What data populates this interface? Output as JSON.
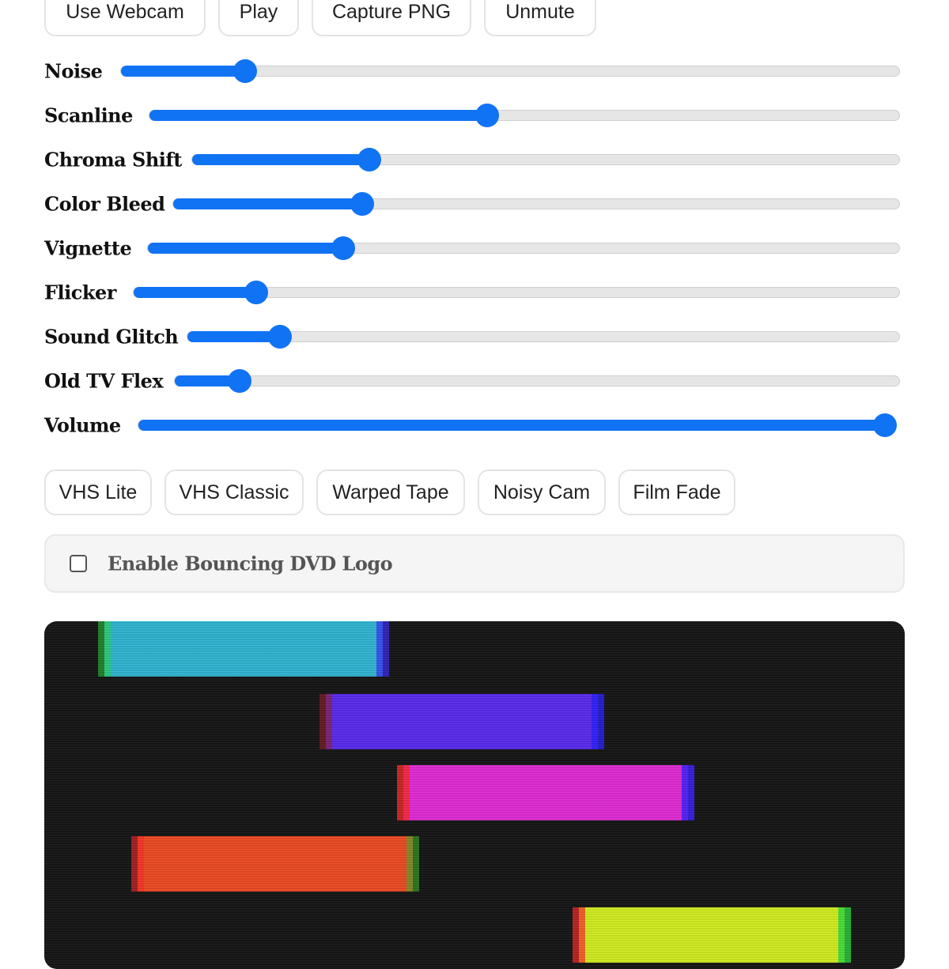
{
  "toolbar": {
    "buttons": [
      {
        "label": "Use Webcam"
      },
      {
        "label": "Play"
      },
      {
        "label": "Capture PNG"
      },
      {
        "label": "Unmute"
      }
    ]
  },
  "sliders": [
    {
      "label": "Noise",
      "value": 0.16
    },
    {
      "label": "Scanline",
      "value": 0.45
    },
    {
      "label": "Chroma Shift",
      "value": 0.25
    },
    {
      "label": "Color Bleed",
      "value": 0.26
    },
    {
      "label": "Vignette",
      "value": 0.26
    },
    {
      "label": "Flicker",
      "value": 0.16
    },
    {
      "label": "Sound Glitch",
      "value": 0.13
    },
    {
      "label": "Old TV Flex",
      "value": 0.09
    },
    {
      "label": "Volume",
      "value": 1.0
    }
  ],
  "presets": [
    {
      "label": "VHS Lite"
    },
    {
      "label": "VHS Classic"
    },
    {
      "label": "Warped Tape"
    },
    {
      "label": "Noisy Cam"
    },
    {
      "label": "Film Fade"
    }
  ],
  "dvd_logo": {
    "label": "Enable Bouncing DVD Logo",
    "checked": false
  },
  "colors": {
    "accent": "#1073f4",
    "bar_cyan": "#2fb6d4",
    "bar_violet": "#5a2af0",
    "bar_magenta": "#e32ad6",
    "bar_orange": "#ef4a22",
    "bar_yellow": "#d4ef1f"
  }
}
